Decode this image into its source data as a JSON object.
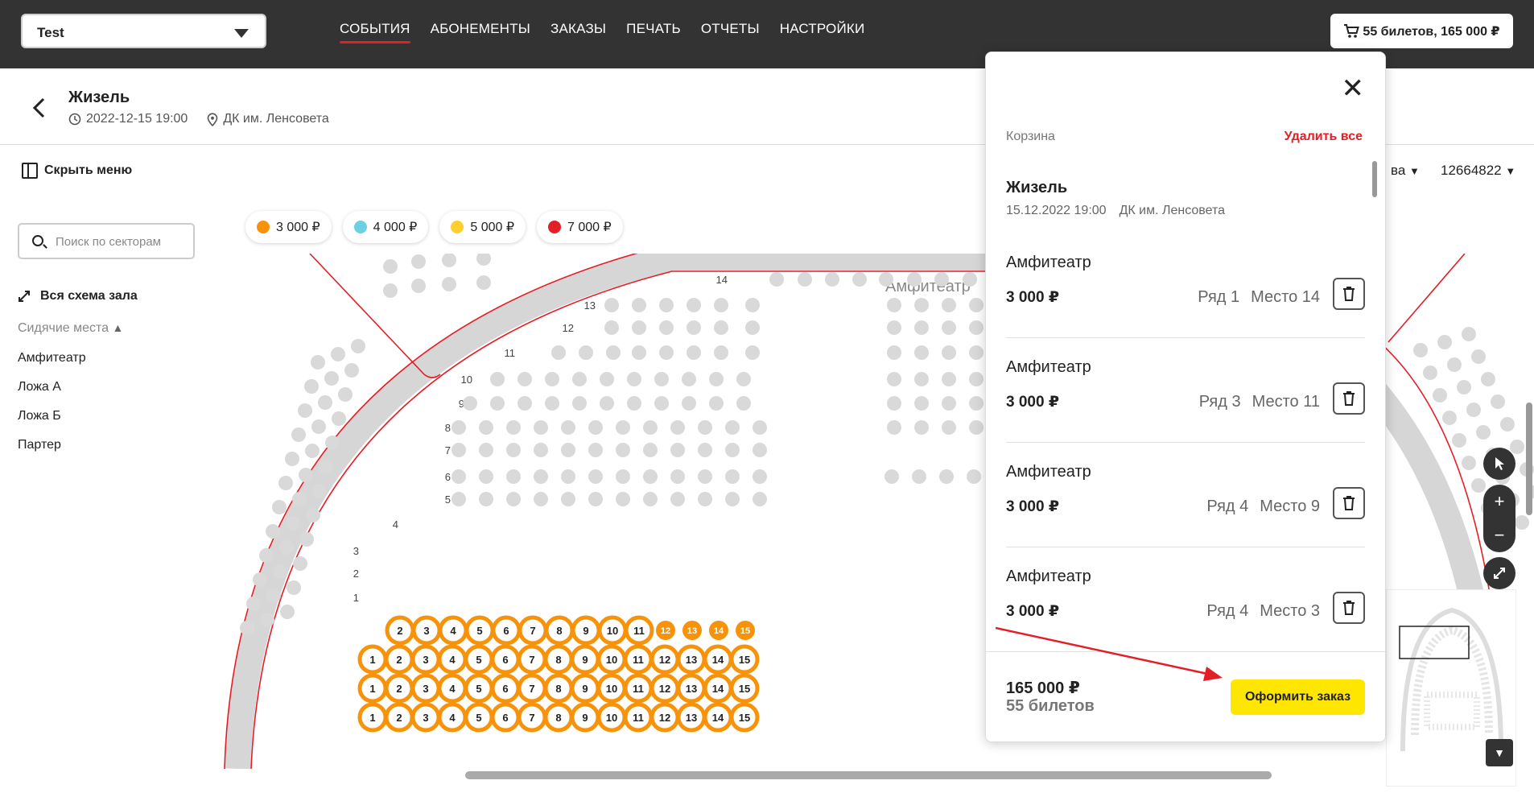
{
  "org_select": {
    "value": "Test"
  },
  "nav": [
    "СОБЫТИЯ",
    "АБОНЕМЕНТЫ",
    "ЗАКАЗЫ",
    "ПЕЧАТЬ",
    "ОТЧЕТЫ",
    "НАСТРОЙКИ"
  ],
  "cart_button": "55 билетов, 165 000 ₽",
  "event": {
    "title": "Жизель",
    "datetime": "2022-12-15 19:00",
    "venue": "ДК им. Ленсовета"
  },
  "toolbar": {
    "hide_menu": "Скрыть меню",
    "right_label": "ва",
    "right_id": "12664822"
  },
  "sidebar": {
    "search_placeholder": "Поиск по секторам",
    "whole_scheme": "Вся схема зала",
    "seated_label": "Сидячие места",
    "sectors": [
      "Амфитеатр",
      "Ложа А",
      "Ложа Б",
      "Партер"
    ]
  },
  "legend": [
    {
      "price": "3 000 ₽",
      "color": "#f7930a"
    },
    {
      "price": "4 000 ₽",
      "color": "#6bd0e0"
    },
    {
      "price": "5 000 ₽",
      "color": "#ffcf30"
    },
    {
      "price": "7 000 ₽",
      "color": "#e41e26"
    }
  ],
  "map": {
    "sector_label": "Амфитеатр",
    "row_labels": [
      "14",
      "13",
      "12",
      "11",
      "10",
      "9",
      "8",
      "7",
      "6",
      "5",
      "4",
      "3",
      "2",
      "1"
    ],
    "selected_color": "#f7930a",
    "free_color": "#d9d9d9"
  },
  "cart": {
    "label": "Корзина",
    "clear_all": "Удалить все",
    "event_title": "Жизель",
    "event_date": "15.12.2022 19:00",
    "event_venue": "ДК им. Ленсовета",
    "tickets": [
      {
        "sector": "Амфитеатр",
        "price": "3 000 ₽",
        "row": "Ряд 1",
        "seat": "Место 14"
      },
      {
        "sector": "Амфитеатр",
        "price": "3 000 ₽",
        "row": "Ряд 3",
        "seat": "Место 11"
      },
      {
        "sector": "Амфитеатр",
        "price": "3 000 ₽",
        "row": "Ряд 4",
        "seat": "Место 9"
      },
      {
        "sector": "Амфитеатр",
        "price": "3 000 ₽",
        "row": "Ряд 4",
        "seat": "Место 3"
      }
    ],
    "total": "165 000 ₽",
    "count": "55 билетов",
    "order_button": "Оформить заказ"
  }
}
